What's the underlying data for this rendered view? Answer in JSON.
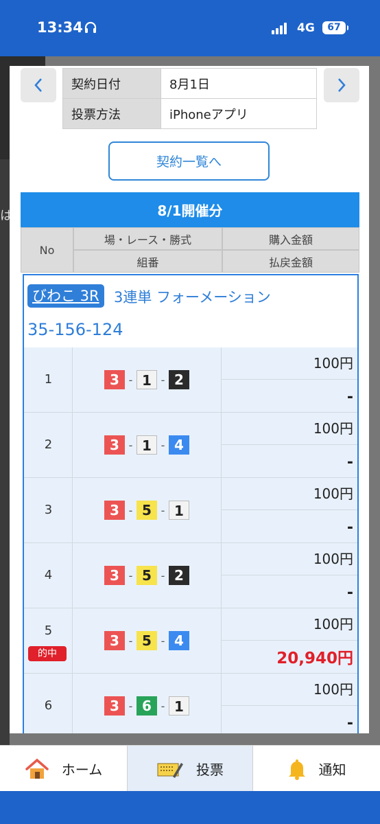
{
  "status": {
    "time": "13:34",
    "network": "4G",
    "battery": "67"
  },
  "backdrop": {
    "side_text": "は"
  },
  "contract": {
    "date_label": "契約日付",
    "date_value": "8月1日",
    "method_label": "投票方法",
    "method_value": "iPhoneアプリ",
    "list_button": "契約一覧へ"
  },
  "section": {
    "title": "8/1開催分"
  },
  "columns": {
    "no": "No",
    "race": "場・レース・勝式",
    "purchase": "購入金額",
    "combo": "組番",
    "payout": "払戻金額"
  },
  "ticket": {
    "venue": "びわこ 3R",
    "bet_type": "3連単 フォーメーション",
    "combination": "35-156-124",
    "rows": [
      {
        "no": "1",
        "boats": [
          "3",
          "1",
          "2"
        ],
        "amount": "100円",
        "payout": "-",
        "hit": ""
      },
      {
        "no": "2",
        "boats": [
          "3",
          "1",
          "4"
        ],
        "amount": "100円",
        "payout": "-",
        "hit": ""
      },
      {
        "no": "3",
        "boats": [
          "3",
          "5",
          "1"
        ],
        "amount": "100円",
        "payout": "-",
        "hit": ""
      },
      {
        "no": "4",
        "boats": [
          "3",
          "5",
          "2"
        ],
        "amount": "100円",
        "payout": "-",
        "hit": ""
      },
      {
        "no": "5",
        "boats": [
          "3",
          "5",
          "4"
        ],
        "amount": "100円",
        "payout": "20,940円",
        "hit": "的中"
      },
      {
        "no": "6",
        "boats": [
          "3",
          "6",
          "1"
        ],
        "amount": "100円",
        "payout": "-",
        "hit": ""
      }
    ]
  },
  "tabs": {
    "home": "ホーム",
    "vote": "投票",
    "notice": "通知"
  },
  "colors": {
    "accent": "#1e8ce8",
    "brand": "#1e63c9",
    "hit": "#e0202a"
  },
  "icons": {
    "prev": "chevron-left-icon",
    "next": "chevron-right-icon",
    "home": "house-icon",
    "vote": "ticket-pencil-icon",
    "notice": "bell-icon"
  }
}
